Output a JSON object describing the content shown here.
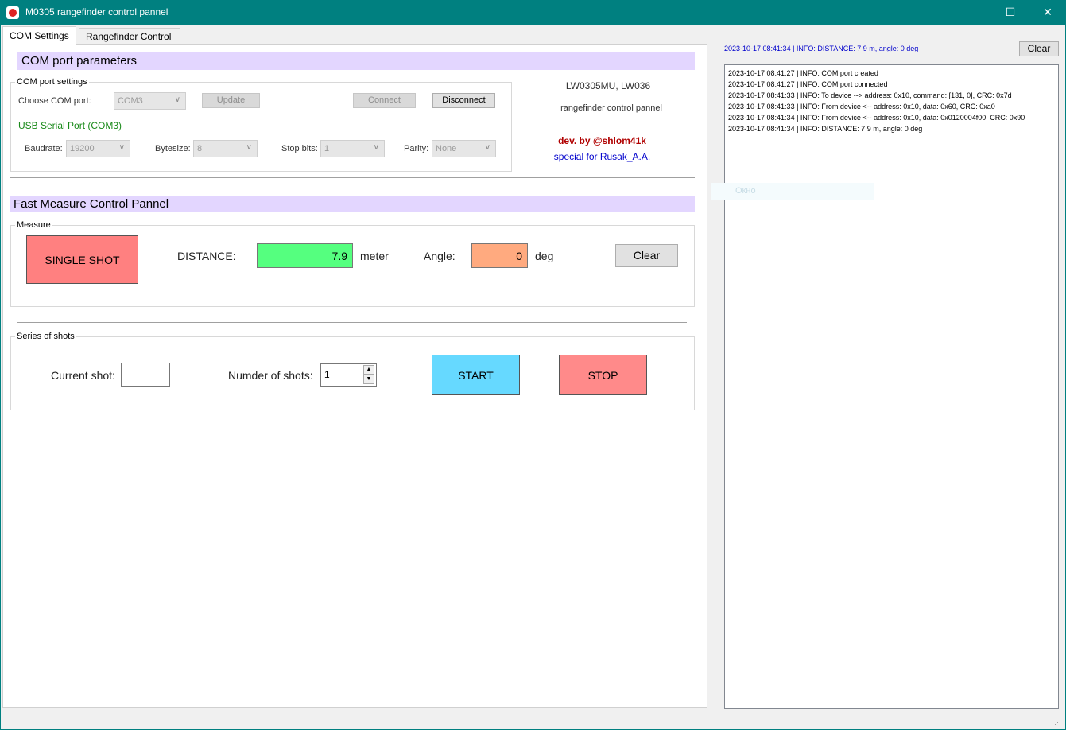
{
  "window": {
    "title": "M0305 rangefinder control pannel",
    "minimize": "—",
    "maximize": "☐",
    "close": "✕"
  },
  "tabs": [
    {
      "label": "COM Settings"
    },
    {
      "label": "Rangefinder Control"
    }
  ],
  "com_section": {
    "header": "COM port parameters",
    "group_label": "COM port settings",
    "choose_port_label": "Choose COM port:",
    "port_value": "COM3",
    "update_label": "Update",
    "connect_label": "Connect",
    "disconnect_label": "Disconnect",
    "device_name": "USB Serial Port (COM3)",
    "baudrate_label": "Baudrate:",
    "baudrate_value": "19200",
    "bytesize_label": "Bytesize:",
    "bytesize_value": "8",
    "stopbits_label": "Stop bits:",
    "stopbits_value": "1",
    "parity_label": "Parity:",
    "parity_value": "None"
  },
  "info": {
    "model": "LW0305MU, LW036",
    "pannel": "rangefinder control pannel",
    "dev": "dev. by @shlom41k",
    "special": "special for Rusak_A.A."
  },
  "measure": {
    "header": "Fast Measure Control Pannel",
    "group_label": "Measure",
    "single_shot_label": "SINGLE SHOT",
    "distance_label": "DISTANCE:",
    "distance_value": "7.9",
    "distance_unit": "meter",
    "angle_label": "Angle:",
    "angle_value": "0",
    "angle_unit": "deg",
    "clear_label": "Clear"
  },
  "series": {
    "group_label": "Series of shots",
    "current_label": "Current shot:",
    "current_value": "",
    "number_label": "Numder of shots:",
    "number_value": "1",
    "start_label": "START",
    "stop_label": "STOP"
  },
  "log": {
    "last_message": "2023-10-17 08:41:34 | INFO: DISTANCE: 7.9 m, angle: 0 deg",
    "clear_label": "Clear",
    "lines": [
      "2023-10-17 08:41:27 | INFO: COM port created",
      "2023-10-17 08:41:27 | INFO: COM port connected",
      "2023-10-17 08:41:33 | INFO: To device --> address: 0x10, command: [131, 0], CRC: 0x7d",
      "2023-10-17 08:41:33 | INFO: From device <-- address: 0x10, data: 0x60, CRC: 0xa0",
      "2023-10-17 08:41:34 | INFO: From device <-- address: 0x10, data: 0x0120004f00, CRC: 0x90",
      "2023-10-17 08:41:34 | INFO: DISTANCE: 7.9 m, angle: 0 deg"
    ]
  },
  "ghost_label": "Окно",
  "colors": {
    "titlebar": "#008080",
    "section_header": "#e3d6ff",
    "single_shot": "#ff8080",
    "distance_field": "#55ff7f",
    "angle_field": "#ffaa7f",
    "start": "#66d9ff",
    "stop": "#ff8a8a",
    "device_name": "#1a8a1a",
    "dev_text": "#b00000",
    "special_text": "#0000cc"
  }
}
